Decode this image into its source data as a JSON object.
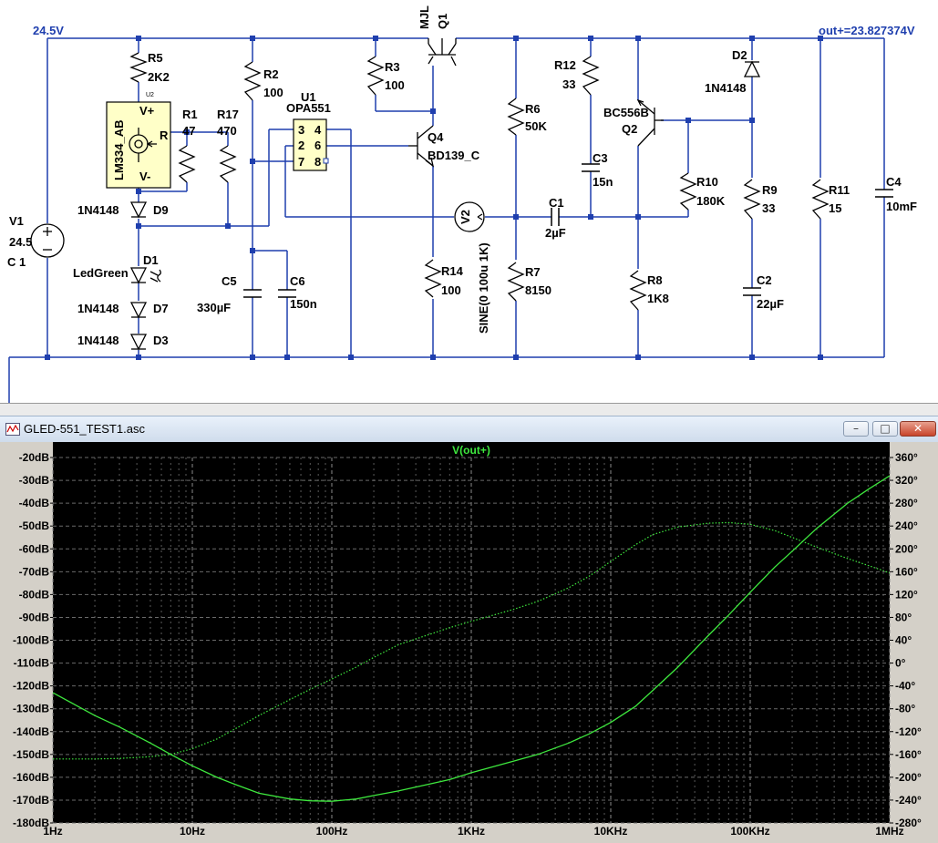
{
  "schematic": {
    "net_labels": {
      "vin": "24.5V",
      "vout": "out+=23.827374V"
    },
    "components": {
      "v1": {
        "ref": "V1",
        "value": "24.5",
        "extra": "C 1"
      },
      "r5": {
        "ref": "R5",
        "value": "2K2"
      },
      "u2": {
        "ref": "U2",
        "part": "LM334_AB",
        "pin_vplus": "V+",
        "pin_r": "R",
        "pin_vminus": "V-"
      },
      "r1": {
        "ref": "R1",
        "value": "47"
      },
      "r17": {
        "ref": "R17",
        "value": "470"
      },
      "r2": {
        "ref": "R2",
        "value": "100"
      },
      "u1": {
        "ref": "U1",
        "part": "OPA551",
        "pins": [
          "3",
          "4",
          "2",
          "6",
          "7",
          "8"
        ]
      },
      "d9": {
        "ref": "D9",
        "value": "1N4148"
      },
      "d1": {
        "ref": "D1",
        "value": "LedGreen"
      },
      "d7": {
        "ref": "D7",
        "value": "1N4148"
      },
      "d3": {
        "ref": "D3",
        "value": "1N4148"
      },
      "c5": {
        "ref": "C5",
        "value": "330µF"
      },
      "c6": {
        "ref": "C6",
        "value": "150n"
      },
      "q1": {
        "ref": "Q1",
        "value": "MJL"
      },
      "r3": {
        "ref": "R3",
        "value": "100"
      },
      "q4": {
        "ref": "Q4",
        "value": "BD139_C"
      },
      "v2": {
        "ref": "V2",
        "value": "SINE(0 100u 1K)"
      },
      "r14": {
        "ref": "R14",
        "value": "100"
      },
      "r6": {
        "ref": "R6",
        "value": "50K"
      },
      "r7": {
        "ref": "R7",
        "value": "8150"
      },
      "r12": {
        "ref": "R12",
        "value": "33"
      },
      "c3": {
        "ref": "C3",
        "value": "15n"
      },
      "c1": {
        "ref": "C1",
        "value": "2µF"
      },
      "q2": {
        "ref": "Q2",
        "value": "BC556B"
      },
      "r10": {
        "ref": "R10",
        "value": "180K"
      },
      "r8": {
        "ref": "R8",
        "value": "1K8"
      },
      "d2": {
        "ref": "D2",
        "value": "1N4148"
      },
      "r9": {
        "ref": "R9",
        "value": "33"
      },
      "c2": {
        "ref": "C2",
        "value": "22µF"
      },
      "r11": {
        "ref": "R11",
        "value": "15"
      },
      "c4": {
        "ref": "C4",
        "value": "10mF"
      }
    }
  },
  "plot_window": {
    "title": "GLED-551_TEST1.asc",
    "buttons": {
      "minimize": "–",
      "restore": "□",
      "close": "✕"
    }
  },
  "chart_data": {
    "type": "line",
    "title": "V(out+)",
    "x_scale": "log",
    "x_ticks": [
      "1Hz",
      "10Hz",
      "100Hz",
      "1KHz",
      "10KHz",
      "100KHz",
      "1MHz"
    ],
    "xlim": [
      1,
      1000000
    ],
    "y_left_ticks": [
      "-20dB",
      "-30dB",
      "-40dB",
      "-50dB",
      "-60dB",
      "-70dB",
      "-80dB",
      "-90dB",
      "-100dB",
      "-110dB",
      "-120dB",
      "-130dB",
      "-140dB",
      "-150dB",
      "-160dB",
      "-170dB",
      "-180dB"
    ],
    "y_left_lim": [
      -180,
      -20
    ],
    "y_right_ticks": [
      "360°",
      "320°",
      "280°",
      "240°",
      "200°",
      "160°",
      "120°",
      "80°",
      "40°",
      "0°",
      "-40°",
      "-80°",
      "-120°",
      "-160°",
      "-200°",
      "-240°",
      "-280°"
    ],
    "y_right_lim": [
      -280,
      360
    ],
    "grid": true,
    "trace_color": "#3ee83e",
    "series": [
      {
        "axis": "left",
        "style": "solid",
        "x": [
          1,
          2,
          3,
          5,
          7,
          10,
          15,
          20,
          30,
          50,
          70,
          100,
          150,
          200,
          300,
          500,
          700,
          1000,
          2000,
          3000,
          5000,
          7000,
          10000,
          15000,
          20000,
          30000,
          50000,
          70000,
          100000,
          150000,
          200000,
          300000,
          500000,
          700000,
          1000000
        ],
        "y": [
          -123,
          -133,
          -138,
          -145,
          -150,
          -155,
          -160,
          -163,
          -167,
          -169.5,
          -170.3,
          -170.5,
          -169.5,
          -168,
          -166,
          -163,
          -161,
          -158,
          -153,
          -150,
          -145,
          -141,
          -136,
          -129,
          -122,
          -112,
          -98,
          -89,
          -79,
          -68,
          -61,
          -51,
          -40,
          -34,
          -28
        ]
      },
      {
        "axis": "right",
        "style": "dotted",
        "x": [
          1,
          2,
          3,
          5,
          7,
          10,
          15,
          20,
          30,
          50,
          70,
          100,
          150,
          200,
          300,
          500,
          700,
          1000,
          2000,
          3000,
          5000,
          7000,
          10000,
          15000,
          20000,
          30000,
          50000,
          70000,
          100000,
          150000,
          200000,
          300000,
          500000,
          700000,
          1000000
        ],
        "y": [
          -168,
          -168,
          -167,
          -164,
          -160,
          -150,
          -133,
          -116,
          -92,
          -64,
          -46,
          -28,
          -7,
          10,
          32,
          50,
          62,
          73,
          94,
          108,
          132,
          152,
          178,
          207,
          225,
          238,
          245,
          246,
          243,
          232,
          220,
          203,
          183,
          171,
          158
        ]
      }
    ]
  }
}
